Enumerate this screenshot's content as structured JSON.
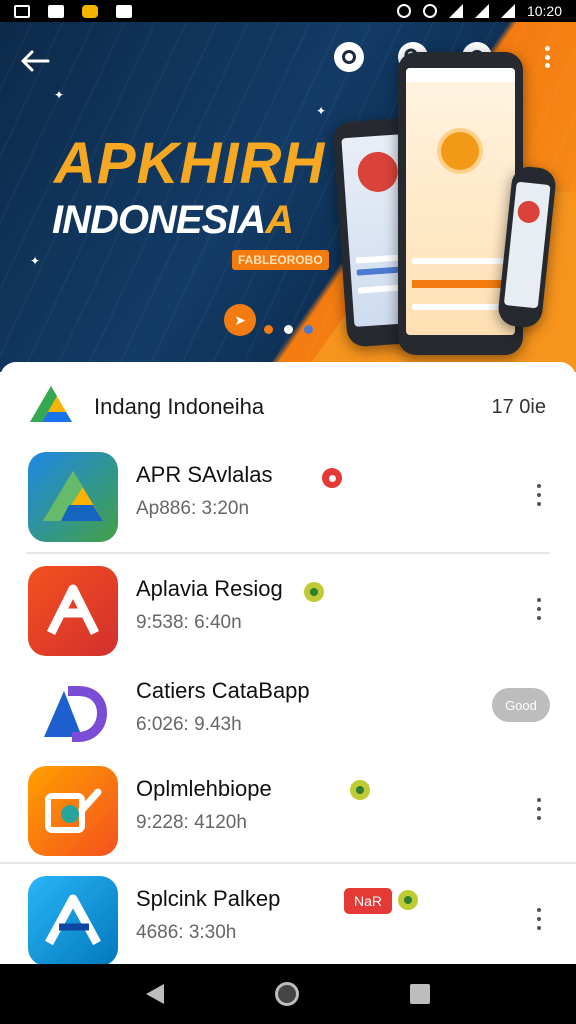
{
  "status_bar": {
    "time": "10:20"
  },
  "banner": {
    "title_line1": "APKHIRH",
    "title_line2_main": "INDONESIA",
    "title_line2_accent": "A",
    "tagline": "FABLEOROBO",
    "active_slide": 2,
    "slide_count": 3
  },
  "list": {
    "header_title": "Indang Indoneiha",
    "header_count": "17 0ie",
    "apps": [
      {
        "name": "APR SAvlalas",
        "meta": "Ap886: 3:20n"
      },
      {
        "name": "Aplavia Resiog",
        "meta": "9:538: 6:40n"
      },
      {
        "name": "Catiers CataBapp",
        "meta": "6:026: 9.43h",
        "pill": "Good"
      },
      {
        "name": "Oplmlehbiope",
        "meta": "9:228: 4120h"
      },
      {
        "name": "Splcink Palkep",
        "meta": "4686: 3:30h",
        "tag": "NaR"
      }
    ]
  },
  "colors": {
    "banner_dark": "#0d2a4a",
    "accent_orange": "#f47b10",
    "title_yellow": "#f7a823"
  }
}
